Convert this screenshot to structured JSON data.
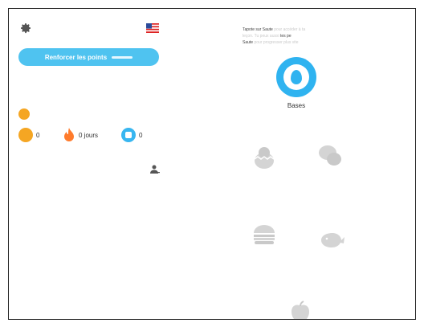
{
  "header": {
    "settings_icon": "gear-icon",
    "flag_icon": "us-flag-icon",
    "strengthen_label": "Renforcer les points"
  },
  "stats": {
    "lingots": "0",
    "streak": "0 jours",
    "gems": "0"
  },
  "hint": {
    "line1_bold": "Tapote sur Saute",
    "line1_faint": "pour accéder à ta",
    "line2_faint": "leçon. Tu peux aussi",
    "line2_bold": "tes pe",
    "line3_bold": "Saute",
    "line3_faint": "pour progresser plus vite"
  },
  "skills": {
    "basics": {
      "label": "Bases",
      "icon": "egg-icon"
    }
  },
  "colors": {
    "accent": "#4fc3f0",
    "basics": "#2fb3f0",
    "lingot": "#f5a623",
    "streak": "#ff7b2c",
    "gem": "#38b6f0",
    "locked": "#c8c8c8"
  }
}
